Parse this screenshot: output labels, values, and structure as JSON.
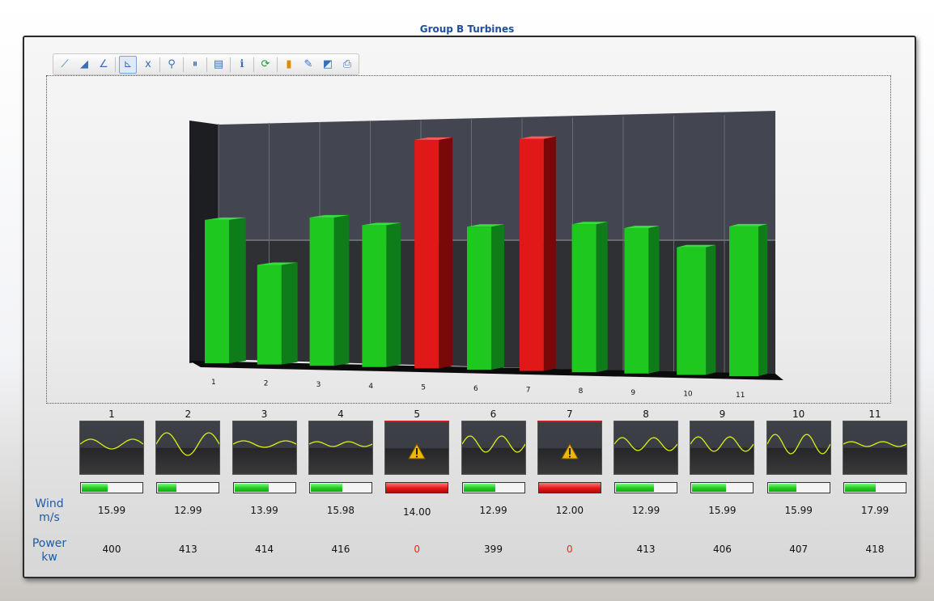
{
  "window": {
    "title": "Group B Turbines"
  },
  "toolbar": {
    "icons": [
      "series-icon",
      "area-icon",
      "line-icon",
      "axes-icon",
      "xy-icon",
      "zoom-icon",
      "pause-icon",
      "grid-icon",
      "info-icon",
      "refresh-icon",
      "export-icon",
      "edit-icon",
      "chart-icon",
      "print-icon"
    ],
    "active_index": 3
  },
  "labels": {
    "wind_line1": "Wind",
    "wind_line2": "m/s",
    "power_line1": "Power",
    "power_line2": "kw"
  },
  "colors": {
    "normal": "#1ec81e",
    "alarm": "#e01818",
    "wave": "#d8f010"
  },
  "chart_data": {
    "type": "bar",
    "categories": [
      "1",
      "2",
      "3",
      "4",
      "5",
      "6",
      "7",
      "8",
      "9",
      "10",
      "11"
    ],
    "values": [
      400,
      278,
      414,
      396,
      638,
      399,
      648,
      413,
      406,
      356,
      418
    ],
    "alarm": [
      false,
      false,
      false,
      false,
      true,
      false,
      true,
      false,
      false,
      false,
      false
    ],
    "ylim": [
      0,
      700
    ],
    "grid": true
  },
  "turbines": [
    {
      "id": "1",
      "wind": "15.99",
      "power": "400",
      "alarm": false,
      "level": 0.42,
      "amp": 6,
      "periods": 1.5
    },
    {
      "id": "2",
      "wind": "12.99",
      "power": "413",
      "alarm": false,
      "level": 0.3,
      "amp": 14,
      "periods": 1.5
    },
    {
      "id": "3",
      "wind": "13.99",
      "power": "414",
      "alarm": false,
      "level": 0.56,
      "amp": 4,
      "periods": 1.5
    },
    {
      "id": "4",
      "wind": "15.98",
      "power": "416",
      "alarm": false,
      "level": 0.52,
      "amp": 3,
      "periods": 2
    },
    {
      "id": "5",
      "wind": "14.00",
      "power": "0",
      "alarm": true,
      "level": 1.0,
      "amp": 0,
      "periods": 0
    },
    {
      "id": "6",
      "wind": "12.99",
      "power": "399",
      "alarm": false,
      "level": 0.52,
      "amp": 10,
      "periods": 2
    },
    {
      "id": "7",
      "wind": "12.00",
      "power": "0",
      "alarm": true,
      "level": 1.0,
      "amp": 0,
      "periods": 0
    },
    {
      "id": "8",
      "wind": "12.99",
      "power": "413",
      "alarm": false,
      "level": 0.62,
      "amp": 8,
      "periods": 2
    },
    {
      "id": "9",
      "wind": "15.99",
      "power": "406",
      "alarm": false,
      "level": 0.55,
      "amp": 9,
      "periods": 2
    },
    {
      "id": "10",
      "wind": "15.99",
      "power": "407",
      "alarm": false,
      "level": 0.45,
      "amp": 12,
      "periods": 2
    },
    {
      "id": "11",
      "wind": "17.99",
      "power": "418",
      "alarm": false,
      "level": 0.5,
      "amp": 3,
      "periods": 2
    }
  ]
}
